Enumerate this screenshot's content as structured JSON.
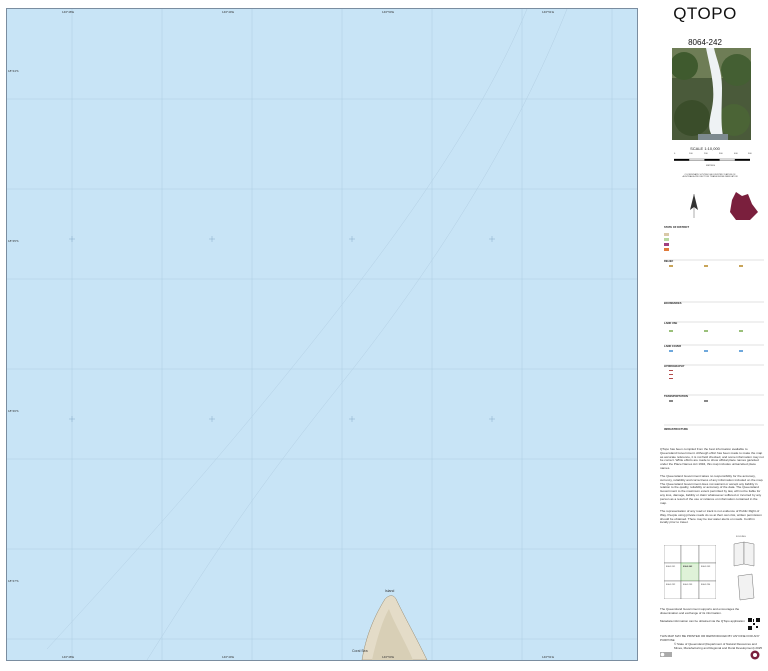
{
  "title": "QTOPO",
  "sheet_number": "8064-242",
  "scale": "SCALE 1:10,000",
  "scalebar": {
    "ticks": [
      "0",
      "100",
      "200",
      "300",
      "400",
      "500"
    ],
    "unit": "METRES"
  },
  "projection_note": "COORDINATE SYSTEM GEOCENTRIC DATUM OF AUSTRALIA PROJECTION TRANSVERSE MERCATOR",
  "map_labels": {
    "top_ticks": [
      "146°48'E",
      "146°49'E",
      "146°50'E",
      "146°51'E"
    ],
    "bottom_ticks": [
      "146°48'E",
      "146°49'E",
      "146°50'E",
      "146°51'E"
    ],
    "left_ticks": [
      "18°44'S",
      "18°45'S",
      "18°46'S",
      "18°47'S"
    ],
    "island_label": "Island",
    "bottom_text": "Coral Sea"
  },
  "legend": {
    "heading": "STATE OF DISTRICT",
    "sections": [
      "RELIEF",
      "BOUNDARIES",
      "LAND USE",
      "LAND COVER",
      "HYDROGRAPHY",
      "TRANSPORTATION",
      "INFRASTRUCTURE"
    ],
    "colors": {
      "water": "#c8e4f6",
      "land": "#d9c9a8",
      "vegetation": "#b6d8a0",
      "road": "#e07a3a",
      "boundary": "#a04080",
      "grid": "#8fb0cc",
      "qld": "#7a1f3d"
    }
  },
  "disclaimer": [
    "QTopo has been compiled from the best information available to Queensland Government. Although effort has been made to make the map as accurate reference, it is not field checked, and some information may not be correct. While efforts are made to show official place names gazetted under the Place Names Act 1994, this map includes unGazetted place names.",
    "The Queensland Government takes no responsibility for the accuracy, currency, reliability and correctness of any information included on the map. The Queensland Government does not warrant or accept any liability in relation to the quality, reliability or accuracy of the data. The Queensland Government to the maximum extent permitted by law, will not be liable for any loss, damage, liability or claim whatsoever suffered or incurred by any person as a result of the use or reliance on information contained in the map.",
    "The representation of any road or track is not evidence of Public Right of Way. People using private roads do so at their own risk, written permission should be obtained. There may be low water alerts on roads. Confirm locally prior to travel."
  ],
  "index": {
    "cells": [
      "8064-241",
      "8064-243",
      "8064-244",
      "8064-232",
      "8064-233",
      "8064-234"
    ],
    "highlight": "8064-242",
    "fold_label": "FOLDING"
  },
  "footer": [
    "The Queensland Government supports and encourages the dissemination and exchange of its information.",
    "Metadata information can be obtained via the QTopo application",
    "THIS MAP MAY BE PRINTED OR REPRODUCED BY ANYONE FOR ANY PURPOSE",
    "© State of Queensland (Department of Natural Resources and Mines, Manufacturing and Regional and Rural Development) 2025"
  ]
}
